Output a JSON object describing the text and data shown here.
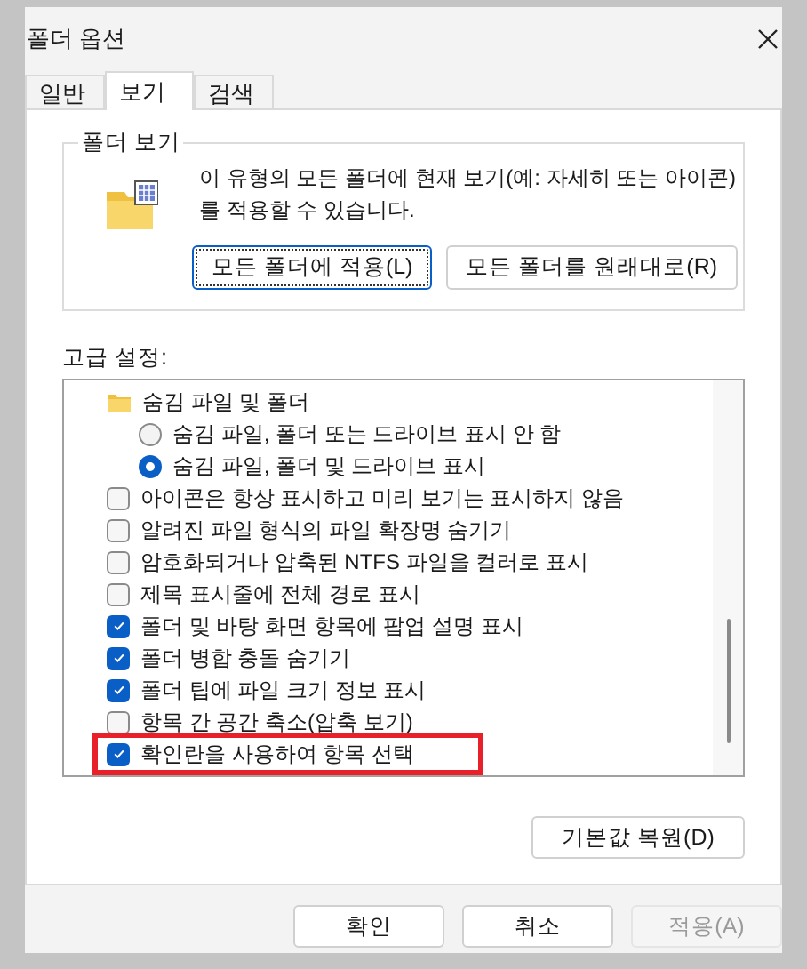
{
  "window": {
    "title": "폴더 옵션"
  },
  "tabs": [
    {
      "label": "일반",
      "selected": false
    },
    {
      "label": "보기",
      "selected": true
    },
    {
      "label": "검색",
      "selected": false
    }
  ],
  "folder_views": {
    "title": "폴더 보기",
    "description": "이 유형의 모든 폴더에 현재 보기(예: 자세히 또는 아이콘)를 적용할 수 있습니다.",
    "buttons": [
      {
        "label": "모든 폴더에 적용(L)",
        "focused": true
      },
      {
        "label": "모든 폴더를 원래대로(R)",
        "focused": false
      }
    ]
  },
  "advanced": {
    "label": "고급 설정:",
    "items": [
      {
        "kind": "folder",
        "label": "숨김 파일 및 폴더",
        "highlighted": false,
        "children": [
          {
            "kind": "radio",
            "label": "숨김 파일, 폴더 또는 드라이브 표시 안 함",
            "selected": false,
            "highlighted": false
          },
          {
            "kind": "radio",
            "label": "숨김 파일, 폴더 및 드라이브 표시",
            "selected": true,
            "highlighted": false
          }
        ]
      },
      {
        "kind": "checkbox",
        "label": "아이콘은 항상 표시하고 미리 보기는 표시하지 않음",
        "checked": false,
        "highlighted": false
      },
      {
        "kind": "checkbox",
        "label": "알려진 파일 형식의 파일 확장명 숨기기",
        "checked": false,
        "highlighted": false
      },
      {
        "kind": "checkbox",
        "label": "암호화되거나 압축된 NTFS 파일을 컬러로 표시",
        "checked": false,
        "highlighted": false
      },
      {
        "kind": "checkbox",
        "label": "제목 표시줄에 전체 경로 표시",
        "checked": false,
        "highlighted": false
      },
      {
        "kind": "checkbox",
        "label": "폴더 및 바탕 화면 항목에 팝업 설명 표시",
        "checked": true,
        "highlighted": false
      },
      {
        "kind": "checkbox",
        "label": "폴더 병합 충돌 숨기기",
        "checked": true,
        "highlighted": false
      },
      {
        "kind": "checkbox",
        "label": "폴더 팁에 파일 크기 정보 표시",
        "checked": true,
        "highlighted": false
      },
      {
        "kind": "checkbox",
        "label": "항목 간 공간 축소(압축 보기)",
        "checked": false,
        "highlighted": false
      },
      {
        "kind": "checkbox",
        "label": "확인란을 사용하여 항목 선택",
        "checked": true,
        "highlighted": true
      }
    ],
    "restore_button": {
      "label": "기본값 복원(D)"
    }
  },
  "footer_buttons": [
    {
      "label": "확인",
      "disabled": false
    },
    {
      "label": "취소",
      "disabled": false
    },
    {
      "label": "적용(A)",
      "disabled": true
    }
  ]
}
